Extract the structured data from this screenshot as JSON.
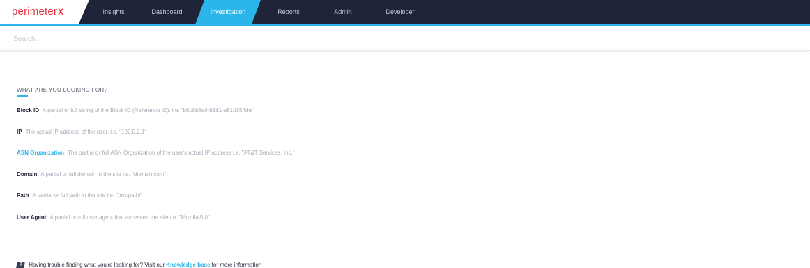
{
  "brand": {
    "logo_text": "perimeter",
    "logo_mark": "X"
  },
  "nav": {
    "items": [
      {
        "label": "Insights"
      },
      {
        "label": "Dashboard"
      },
      {
        "label": "Investigation"
      },
      {
        "label": "Reports"
      },
      {
        "label": "Admin"
      },
      {
        "label": "Developer"
      }
    ],
    "active": "Investigation"
  },
  "search": {
    "placeholder": "Search...",
    "value": ""
  },
  "main": {
    "section_title": "WHAT ARE YOU LOOKING FOR?",
    "fields": [
      {
        "label": "Block ID",
        "description": "A partial or full string of the Block ID (Reference ID). i.e. \"b5c8b5e0-b1d1-a51d354de\""
      },
      {
        "label": "IP",
        "description": "The actual IP address of the user. i.e. \"192.0.2.1\""
      },
      {
        "label": "ASN Organization",
        "description": "The partial or full ASN Organization of the user's actual IP address i.e. \"AT&T Services, Inc.\""
      },
      {
        "label": "Domain",
        "description": "A partial or full domain in the site i.e. \"domain.com\""
      },
      {
        "label": "Path",
        "description": "A partial or full path in the site i.e. \"/my.path/\""
      },
      {
        "label": "User Agent",
        "description": "A partial or full user agent that accessed the site i.e. \"Mozilla\\5.0\""
      }
    ]
  },
  "help": {
    "icon": "?",
    "text_before": "Having trouble finding what you're looking for? Visit our",
    "link_text": "Knowledge base",
    "text_after": "for more information"
  },
  "colors": {
    "nav_bg": "#1f2438",
    "accent": "#2bb5ea",
    "brand_red": "#e8313f"
  }
}
